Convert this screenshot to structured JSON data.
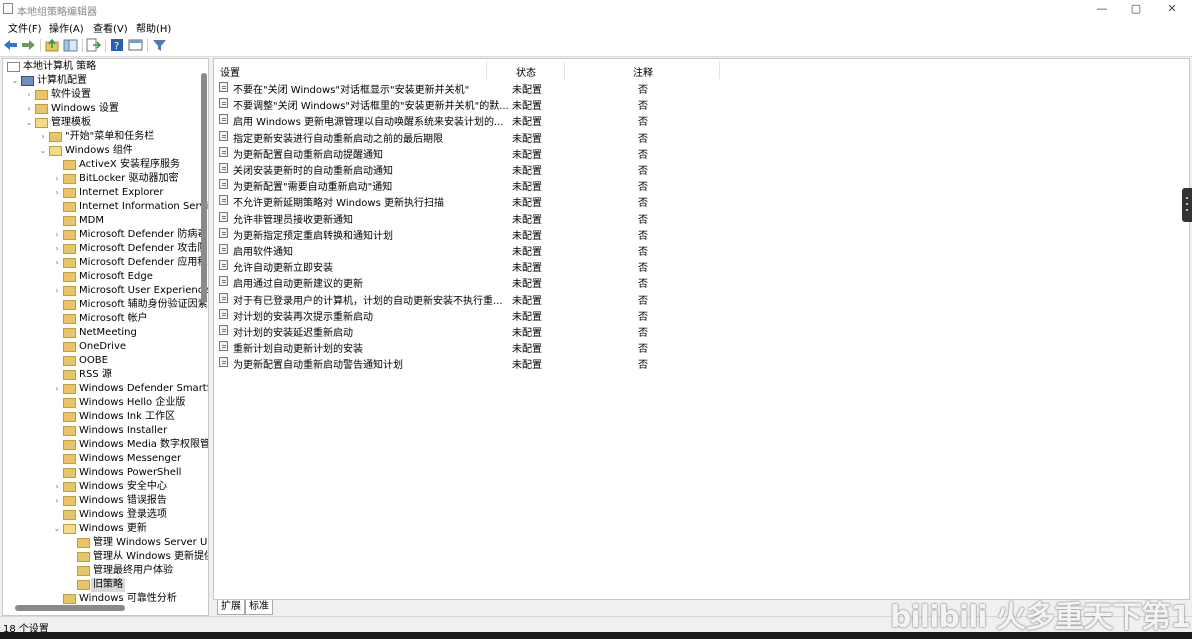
{
  "window": {
    "title": "本地组策略编辑器",
    "buttons": {
      "minimize": "—",
      "maximize": "▢",
      "close": "✕"
    }
  },
  "menu": [
    "文件(F)",
    "操作(A)",
    "查看(V)",
    "帮助(H)"
  ],
  "toolbar": {
    "icons": [
      "back-arrow-icon",
      "forward-arrow-icon",
      "up-folder-icon",
      "show-tree-icon",
      "export-list-icon",
      "help-icon",
      "view-icon",
      "filter-icon"
    ],
    "accent": "#2b78d0"
  },
  "tree": {
    "root": "本地计算机 策略",
    "nodes": [
      {
        "label": "本地计算机 策略",
        "level": 0,
        "expander": "",
        "icon": "computer-policy"
      },
      {
        "label": "计算机配置",
        "level": 1,
        "expander": "⌄",
        "icon": "computer"
      },
      {
        "label": "软件设置",
        "level": 2,
        "expander": "›",
        "icon": "folder"
      },
      {
        "label": "Windows 设置",
        "level": 2,
        "expander": "›",
        "icon": "folder"
      },
      {
        "label": "管理模板",
        "level": 2,
        "expander": "⌄",
        "icon": "folder-open"
      },
      {
        "label": "\"开始\"菜单和任务栏",
        "level": 3,
        "expander": "›",
        "icon": "folder"
      },
      {
        "label": "Windows 组件",
        "level": 3,
        "expander": "⌄",
        "icon": "folder-open"
      },
      {
        "label": "ActiveX 安装程序服务",
        "level": 4,
        "expander": "",
        "icon": "folder"
      },
      {
        "label": "BitLocker 驱动器加密",
        "level": 4,
        "expander": "›",
        "icon": "folder"
      },
      {
        "label": "Internet Explorer",
        "level": 4,
        "expander": "›",
        "icon": "folder"
      },
      {
        "label": "Internet Information Service",
        "level": 4,
        "expander": "",
        "icon": "folder"
      },
      {
        "label": "MDM",
        "level": 4,
        "expander": "",
        "icon": "folder"
      },
      {
        "label": "Microsoft Defender 防病毒",
        "level": 4,
        "expander": "›",
        "icon": "folder"
      },
      {
        "label": "Microsoft Defender 攻击防护",
        "level": 4,
        "expander": "›",
        "icon": "folder"
      },
      {
        "label": "Microsoft Defender 应用程序",
        "level": 4,
        "expander": "›",
        "icon": "folder"
      },
      {
        "label": "Microsoft Edge",
        "level": 4,
        "expander": "",
        "icon": "folder"
      },
      {
        "label": "Microsoft User Experience V",
        "level": 4,
        "expander": "›",
        "icon": "folder"
      },
      {
        "label": "Microsoft 辅助身份验证因素",
        "level": 4,
        "expander": "",
        "icon": "folder"
      },
      {
        "label": "Microsoft 帐户",
        "level": 4,
        "expander": "",
        "icon": "folder"
      },
      {
        "label": "NetMeeting",
        "level": 4,
        "expander": "",
        "icon": "folder"
      },
      {
        "label": "OneDrive",
        "level": 4,
        "expander": "",
        "icon": "folder"
      },
      {
        "label": "OOBE",
        "level": 4,
        "expander": "",
        "icon": "folder"
      },
      {
        "label": "RSS 源",
        "level": 4,
        "expander": "",
        "icon": "folder"
      },
      {
        "label": "Windows Defender SmartSc",
        "level": 4,
        "expander": "›",
        "icon": "folder"
      },
      {
        "label": "Windows Hello 企业版",
        "level": 4,
        "expander": "",
        "icon": "folder"
      },
      {
        "label": "Windows Ink 工作区",
        "level": 4,
        "expander": "",
        "icon": "folder"
      },
      {
        "label": "Windows Installer",
        "level": 4,
        "expander": "",
        "icon": "folder"
      },
      {
        "label": "Windows Media 数字权限管",
        "level": 4,
        "expander": "",
        "icon": "folder"
      },
      {
        "label": "Windows Messenger",
        "level": 4,
        "expander": "",
        "icon": "folder"
      },
      {
        "label": "Windows PowerShell",
        "level": 4,
        "expander": "",
        "icon": "folder"
      },
      {
        "label": "Windows 安全中心",
        "level": 4,
        "expander": "›",
        "icon": "folder"
      },
      {
        "label": "Windows 错误报告",
        "level": 4,
        "expander": "›",
        "icon": "folder"
      },
      {
        "label": "Windows 登录选项",
        "level": 4,
        "expander": "",
        "icon": "folder"
      },
      {
        "label": "Windows 更新",
        "level": 4,
        "expander": "⌄",
        "icon": "folder-open"
      },
      {
        "label": "管理 Windows Server Up",
        "level": 5,
        "expander": "",
        "icon": "folder"
      },
      {
        "label": "管理从 Windows 更新提供",
        "level": 5,
        "expander": "",
        "icon": "folder"
      },
      {
        "label": "管理最终用户体验",
        "level": 5,
        "expander": "",
        "icon": "folder"
      },
      {
        "label": "旧策略",
        "level": 5,
        "expander": "",
        "icon": "folder",
        "selected": true
      },
      {
        "label": "Windows 可靠性分析",
        "level": 4,
        "expander": "",
        "icon": "folder"
      }
    ]
  },
  "list": {
    "columns": [
      "设置",
      "状态",
      "注释"
    ],
    "rows": [
      {
        "setting": "不要在\"关闭 Windows\"对话框显示\"安装更新并关机\"",
        "state": "未配置",
        "comment": "否"
      },
      {
        "setting": "不要调整\"关闭 Windows\"对话框里的\"安装更新并关机\"的默...",
        "state": "未配置",
        "comment": "否"
      },
      {
        "setting": "启用 Windows 更新电源管理以自动唤醒系统来安装计划的...",
        "state": "未配置",
        "comment": "否"
      },
      {
        "setting": "指定更新安装进行自动重新启动之前的最后期限",
        "state": "未配置",
        "comment": "否"
      },
      {
        "setting": "为更新配置自动重新启动提醒通知",
        "state": "未配置",
        "comment": "否"
      },
      {
        "setting": "关闭安装更新时的自动重新启动通知",
        "state": "未配置",
        "comment": "否"
      },
      {
        "setting": "为更新配置\"需要自动重新启动\"通知",
        "state": "未配置",
        "comment": "否"
      },
      {
        "setting": "不允许更新延期策略对 Windows 更新执行扫描",
        "state": "未配置",
        "comment": "否"
      },
      {
        "setting": "允许非管理员接收更新通知",
        "state": "未配置",
        "comment": "否"
      },
      {
        "setting": "为更新指定预定重启转换和通知计划",
        "state": "未配置",
        "comment": "否"
      },
      {
        "setting": "启用软件通知",
        "state": "未配置",
        "comment": "否"
      },
      {
        "setting": "允许自动更新立即安装",
        "state": "未配置",
        "comment": "否"
      },
      {
        "setting": "启用通过自动更新建议的更新",
        "state": "未配置",
        "comment": "否"
      },
      {
        "setting": "对于有已登录用户的计算机，计划的自动更新安装不执行重...",
        "state": "未配置",
        "comment": "否"
      },
      {
        "setting": "对计划的安装再次提示重新启动",
        "state": "未配置",
        "comment": "否"
      },
      {
        "setting": "对计划的安装延迟重新启动",
        "state": "未配置",
        "comment": "否"
      },
      {
        "setting": "重新计划自动更新计划的安装",
        "state": "未配置",
        "comment": "否"
      },
      {
        "setting": "为更新配置自动重新启动警告通知计划",
        "state": "未配置",
        "comment": "否"
      }
    ]
  },
  "tabs": [
    "扩展",
    "标准"
  ],
  "status": "18 个设置",
  "watermark": "bilibili 火多重天下第1"
}
